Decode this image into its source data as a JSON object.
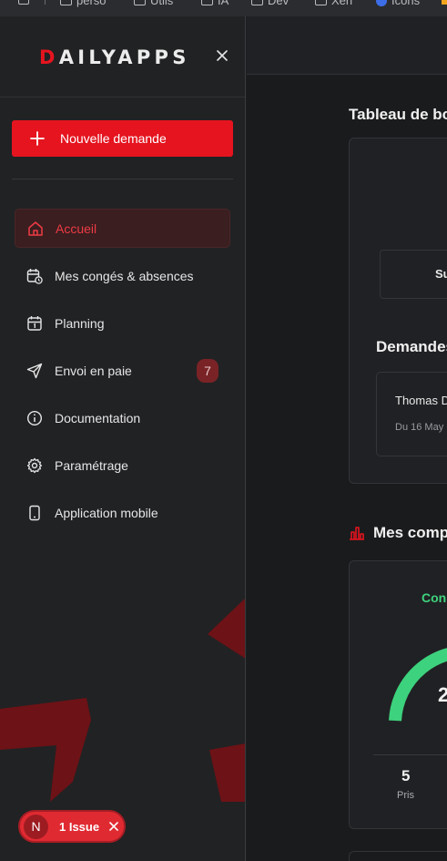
{
  "browser": {
    "bookmarks": [
      "perso",
      "Utils",
      "IA",
      "Dev",
      "Xen",
      "Icons"
    ]
  },
  "sidebar": {
    "logo_first": "D",
    "logo_rest": "AILYAPPS",
    "new_request_label": "Nouvelle demande",
    "items": [
      {
        "label": "Accueil",
        "icon": "home-icon",
        "active": true
      },
      {
        "label": "Mes congés & absences",
        "icon": "calendar-clock-icon"
      },
      {
        "label": "Planning",
        "icon": "calendar-icon"
      },
      {
        "label": "Envoi en paie",
        "icon": "send-icon",
        "badge": "7"
      },
      {
        "label": "Documentation",
        "icon": "info-icon"
      },
      {
        "label": "Paramétrage",
        "icon": "gear-icon"
      },
      {
        "label": "Application mobile",
        "icon": "smartphone-icon"
      }
    ]
  },
  "dev_overlay": {
    "avatar_letter": "N",
    "issue_label": "1 Issue"
  },
  "main": {
    "page_title": "Tableau de bo",
    "summary_box": "Su",
    "demandes_title": "Demandes",
    "request": {
      "name": "Thomas D",
      "date": "Du 16 May"
    },
    "counters_title": "Mes comp",
    "conge_label": "Con",
    "gauge_value": "2",
    "stat_value": "5",
    "stat_label": "Pris"
  },
  "colors": {
    "brand_red": "#e5141f",
    "success_green": "#3dd27d",
    "sidebar_bg": "#212224",
    "main_bg": "#1a1b1d"
  }
}
